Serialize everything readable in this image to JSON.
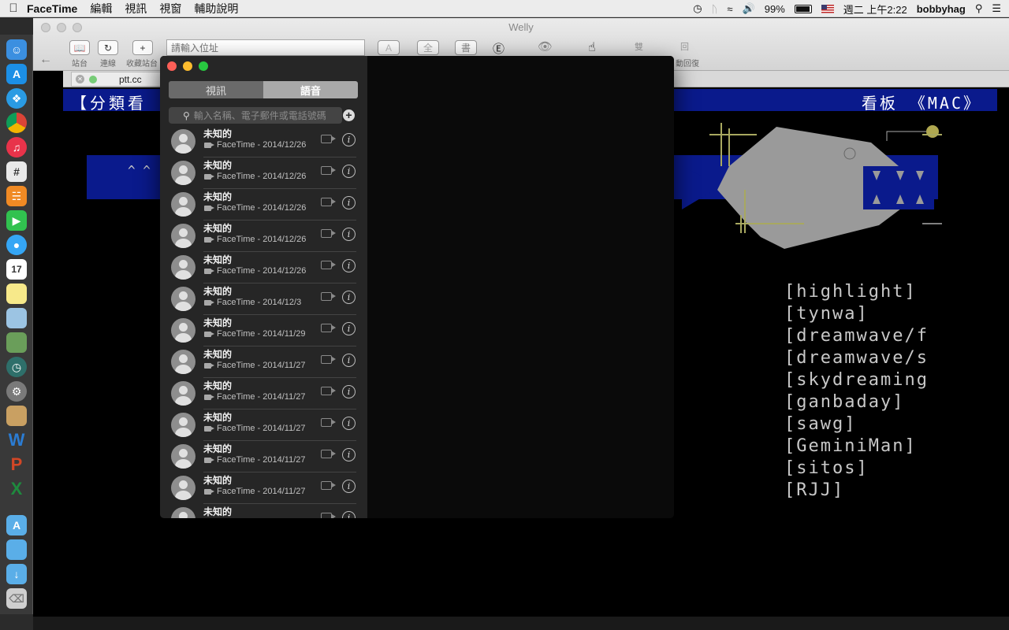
{
  "menubar": {
    "apple": "",
    "app_name": "FaceTime",
    "items": [
      "編輯",
      "視訊",
      "視窗",
      "輔助說明"
    ],
    "battery": "99%",
    "datetime": "週二 上午2:22",
    "user": "bobbyhag"
  },
  "welly": {
    "title": "Welly",
    "address_placeholder": "請輸入位址",
    "toolbar_labels": [
      "站台",
      "連線",
      "收藏站台",
      "動回復"
    ],
    "toolbar_buttons": [
      "全",
      "書",
      "雙",
      "回"
    ],
    "tab_label": "ptt.cc"
  },
  "terminal": {
    "header_left": "【分類看",
    "header_right": "看板 《MAC》",
    "carets": "^ ^",
    "boards": [
      "[highlight]",
      "[tynwa]",
      "[dreamwave/f",
      "[dreamwave/s",
      "[skydreaming",
      "[ganbaday]",
      "[sawg]",
      "[GeminiMan]",
      "[sitos]",
      "[RJJ]"
    ]
  },
  "facetime": {
    "tabs": {
      "video": "視訊",
      "audio": "語音"
    },
    "search_placeholder": "輸入名稱、電子郵件或電話號碼",
    "add_symbol": "+",
    "info_symbol": "i",
    "calls": [
      {
        "name": "未知的",
        "detail": "FaceTime - 2014/12/26"
      },
      {
        "name": "未知的",
        "detail": "FaceTime - 2014/12/26"
      },
      {
        "name": "未知的",
        "detail": "FaceTime - 2014/12/26"
      },
      {
        "name": "未知的",
        "detail": "FaceTime - 2014/12/26"
      },
      {
        "name": "未知的",
        "detail": "FaceTime - 2014/12/26"
      },
      {
        "name": "未知的",
        "detail": "FaceTime - 2014/12/3"
      },
      {
        "name": "未知的",
        "detail": "FaceTime - 2014/11/29"
      },
      {
        "name": "未知的",
        "detail": "FaceTime - 2014/11/27"
      },
      {
        "name": "未知的",
        "detail": "FaceTime - 2014/11/27"
      },
      {
        "name": "未知的",
        "detail": "FaceTime - 2014/11/27"
      },
      {
        "name": "未知的",
        "detail": "FaceTime - 2014/11/27"
      },
      {
        "name": "未知的",
        "detail": "FaceTime - 2014/11/27"
      },
      {
        "name": "未知的",
        "detail": ""
      }
    ]
  },
  "colors": {
    "terminal_blue": "#0a1a8c",
    "traffic_red": "#fc5f57",
    "traffic_yellow": "#fdbc2e",
    "traffic_green": "#28c840",
    "fish_gray": "#9a9a9a",
    "fish_line": "#a8a860"
  },
  "dock_icons": [
    "finder-icon",
    "app-store-icon",
    "safari-icon",
    "chrome-icon",
    "itunes-icon",
    "slack-icon",
    "ibooks-icon",
    "facetime-icon",
    "messages-icon",
    "calendar-icon",
    "notes-icon",
    "preview-icon",
    "iphoto-icon",
    "time-machine-icon",
    "system-preferences-icon",
    "archive-utility-icon",
    "word-icon",
    "powerpoint-icon",
    "excel-icon",
    "applications-folder-icon",
    "documents-folder-icon",
    "downloads-folder-icon",
    "trash-icon"
  ]
}
